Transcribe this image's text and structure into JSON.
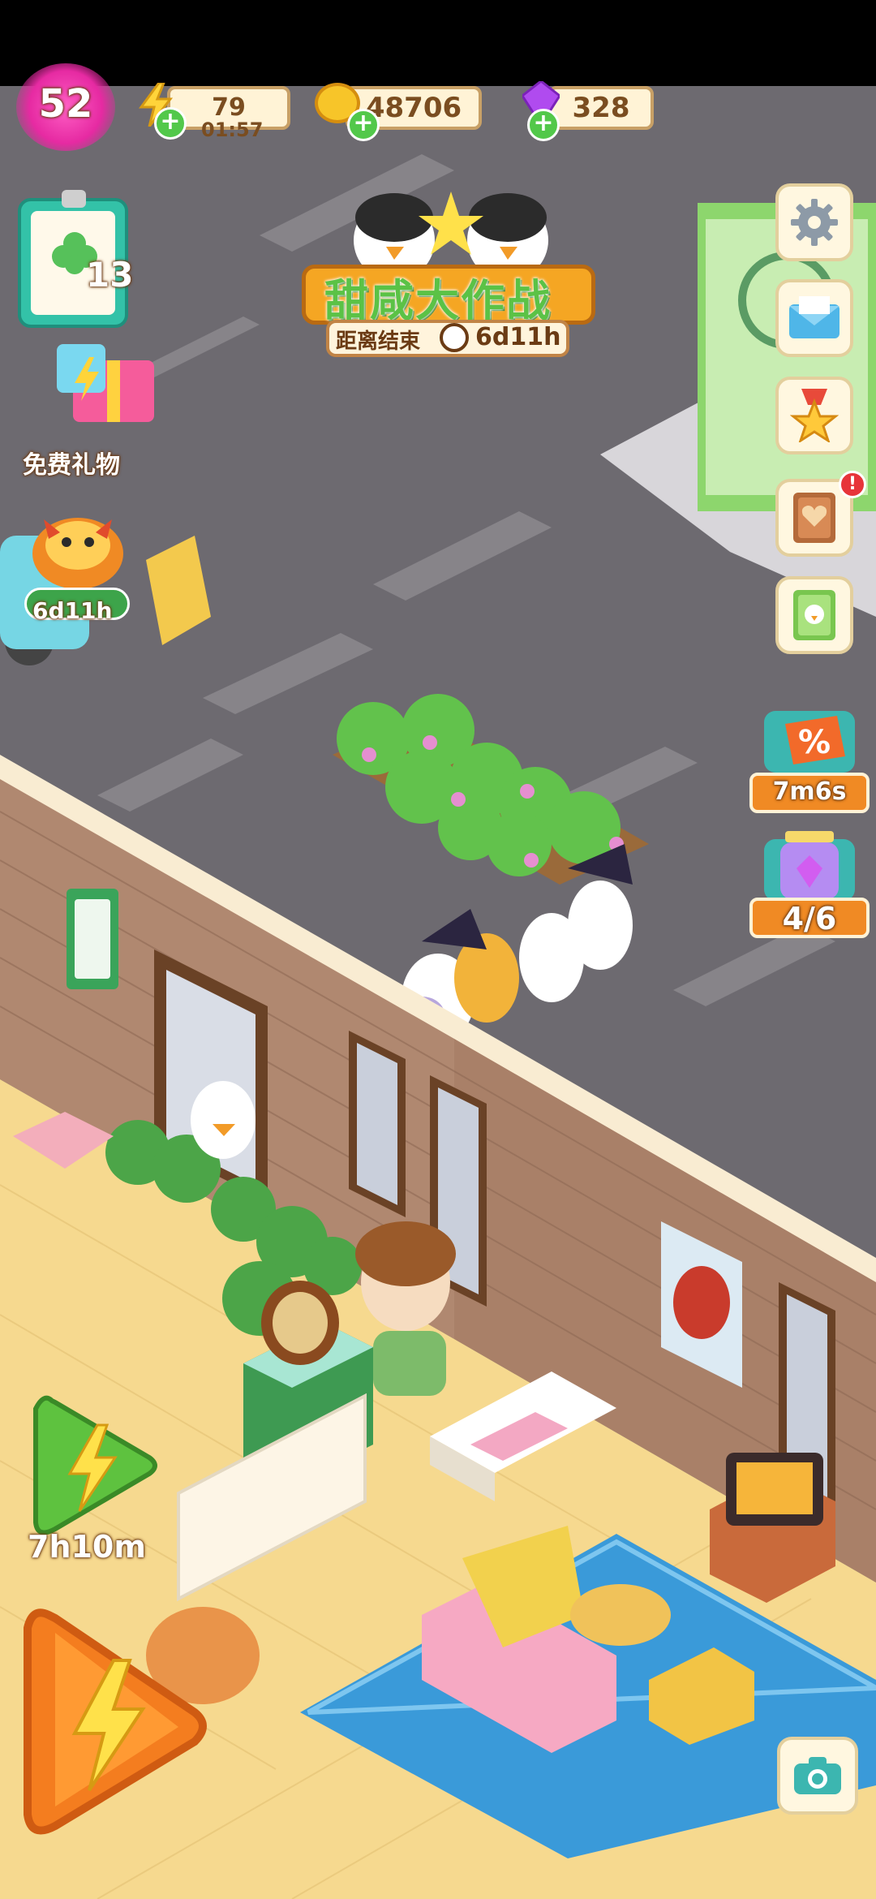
{
  "hud": {
    "level": "52",
    "energy": "79",
    "energy_timer": "01:57",
    "coins": "48706",
    "gems": "328"
  },
  "left_panel": {
    "task_count": "13",
    "free_gift_label": "免费礼物",
    "event_timer": "6d11h",
    "boost_timer": "7h10m"
  },
  "event_banner": {
    "title": "甜咸大作战",
    "countdown_label": "距离结束",
    "countdown": "6d11h"
  },
  "right_panel": {
    "sale_timer": "7m6s",
    "jar_progress": "4/6"
  },
  "colors": {
    "road": "#6d6a70",
    "floor": "#f6d98f",
    "brick": "#b08870",
    "accent_green": "#52c84a",
    "accent_orange": "#f08a24"
  }
}
